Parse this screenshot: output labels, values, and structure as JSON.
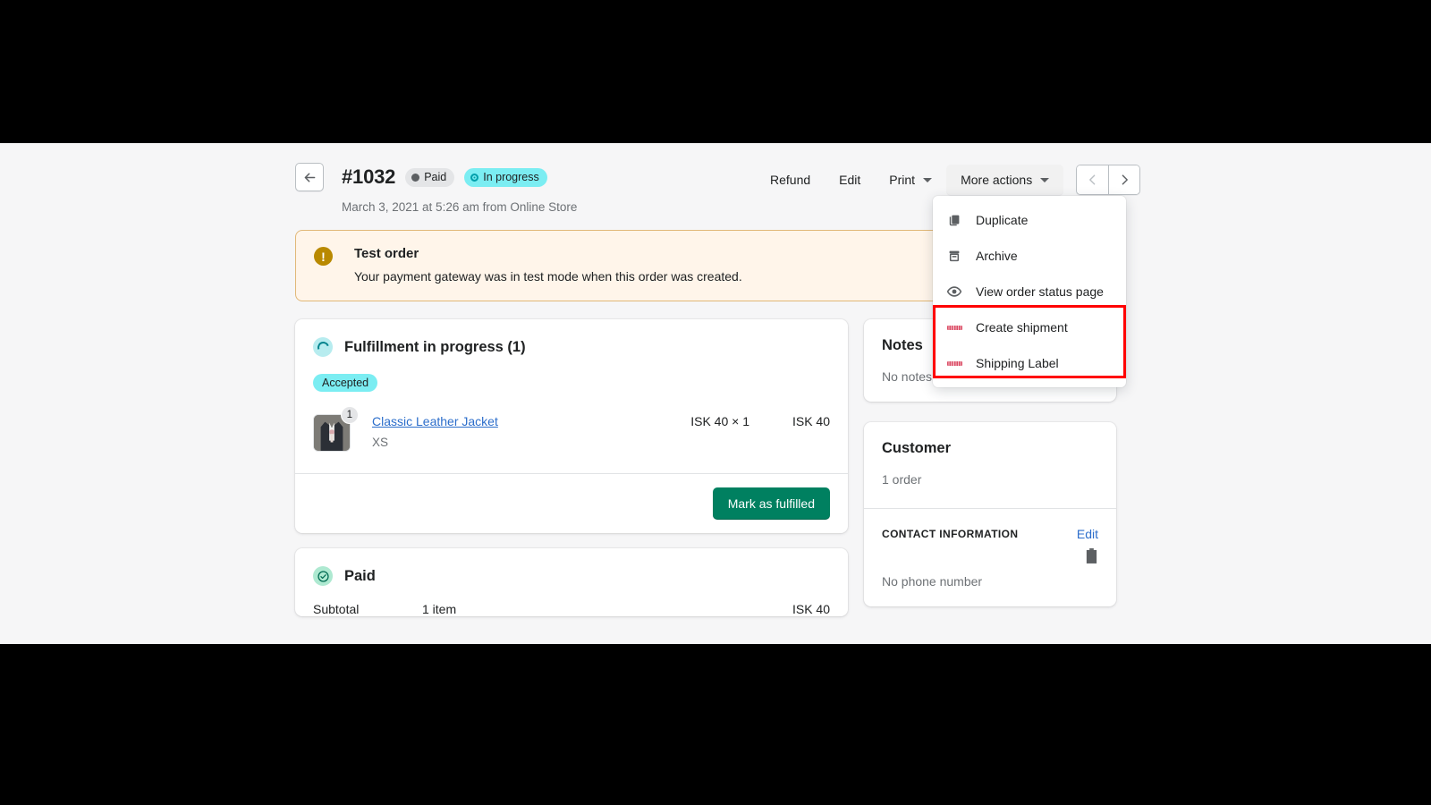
{
  "header": {
    "back_label": "Back",
    "order_id": "#1032",
    "badges": [
      {
        "label": "Paid",
        "style": "paid"
      },
      {
        "label": "In progress",
        "style": "prog"
      }
    ],
    "subtitle": "March 3, 2021 at 5:26 am from Online Store",
    "actions": [
      {
        "label": "Refund",
        "type": "plain"
      },
      {
        "label": "Edit",
        "type": "plain"
      },
      {
        "label": "Print",
        "type": "plain-caret"
      },
      {
        "label": "More actions",
        "type": "solid-caret"
      }
    ],
    "pager": {
      "prev": "Previous order",
      "next": "Next order"
    }
  },
  "dropdown": {
    "open": true,
    "items": [
      {
        "label": "Duplicate",
        "icon": "duplicate-icon"
      },
      {
        "label": "Archive",
        "icon": "archive-icon"
      },
      {
        "label": "View order status page",
        "icon": "eye-icon"
      },
      {
        "label": "Create shipment",
        "icon": "shipping-logo-icon"
      },
      {
        "label": "Shipping Label",
        "icon": "shipping-logo-icon"
      }
    ],
    "highlight_color": "#ff0000"
  },
  "banner": {
    "icon": "alert-icon",
    "title": "Test order",
    "body": "Your payment gateway was in test mode when this order was created.",
    "border_color": "#e1b878",
    "background_color": "#fff5ea"
  },
  "fulfillment": {
    "title": "Fulfillment in progress (1)",
    "status_chip": "Accepted",
    "line_item": {
      "quantity_badge": "1",
      "product": "Classic Leather Jacket",
      "variant": "XS",
      "unit_price": "ISK 40 × 1",
      "total": "ISK 40"
    },
    "primary_button": "Mark as fulfilled"
  },
  "payment": {
    "title": "Paid",
    "rows": [
      {
        "label": "Subtotal",
        "detail": "1 item",
        "amount": "ISK 40"
      }
    ]
  },
  "notes": {
    "title": "Notes",
    "empty_text": "No notes from customer"
  },
  "customer": {
    "title": "Customer",
    "order_count": "1 order",
    "contact_heading": "CONTACT INFORMATION",
    "edit_label": "Edit",
    "phone": "No phone number"
  },
  "colors": {
    "accent_green": "#008060",
    "link_blue": "#2c6ecb",
    "page_bg": "#f6f6f7"
  }
}
